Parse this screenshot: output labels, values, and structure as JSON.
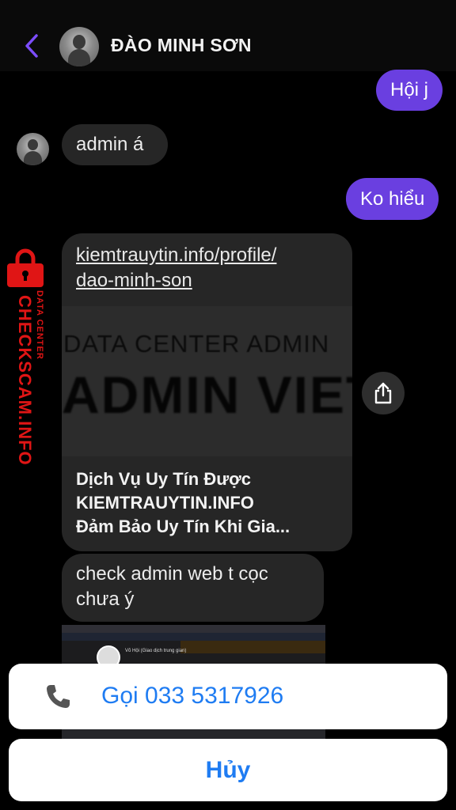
{
  "header": {
    "contact_name": "ĐÀO MINH SƠN",
    "back_icon": "chevron-left-icon",
    "accent_color": "#7c4dff"
  },
  "messages": [
    {
      "direction": "outgoing",
      "text": "Hội j"
    },
    {
      "direction": "incoming",
      "text": "admin á"
    },
    {
      "direction": "outgoing",
      "text": "Ko hiểu"
    },
    {
      "direction": "incoming",
      "type": "link",
      "url_line1": "kiemtrauytin.info/profile/",
      "url_line2": "dao-minh-son",
      "image_text_line1": "DATA CENTER ADMIN",
      "image_text_line2": "ADMIN VIET",
      "title_line1": "Dịch Vụ Uy Tín Được",
      "title_line2": "KIEMTRAUYTIN.INFO",
      "title_line3": "Đảm Bảo Uy Tín Khi Gia..."
    },
    {
      "direction": "incoming",
      "text_line1": "check admin web t cọc",
      "text_line2": "chưa ý"
    },
    {
      "direction": "incoming",
      "type": "image",
      "preview_name": "Võ Hội (Giao dịch trung gian)"
    }
  ],
  "watermark": {
    "main": "CHECKSCAM.INFO",
    "sub": "DATA CENTER",
    "icon": "lock-icon",
    "color": "#e01515"
  },
  "action_sheet": {
    "call_label": "Gọi 033 5317926",
    "call_icon": "phone-icon",
    "cancel_label": "Hủy",
    "button_color": "#1f7cf2"
  },
  "share_icon": "share-icon",
  "outgoing_bubble_color": "#6a3fe0",
  "incoming_bubble_color": "#262626"
}
